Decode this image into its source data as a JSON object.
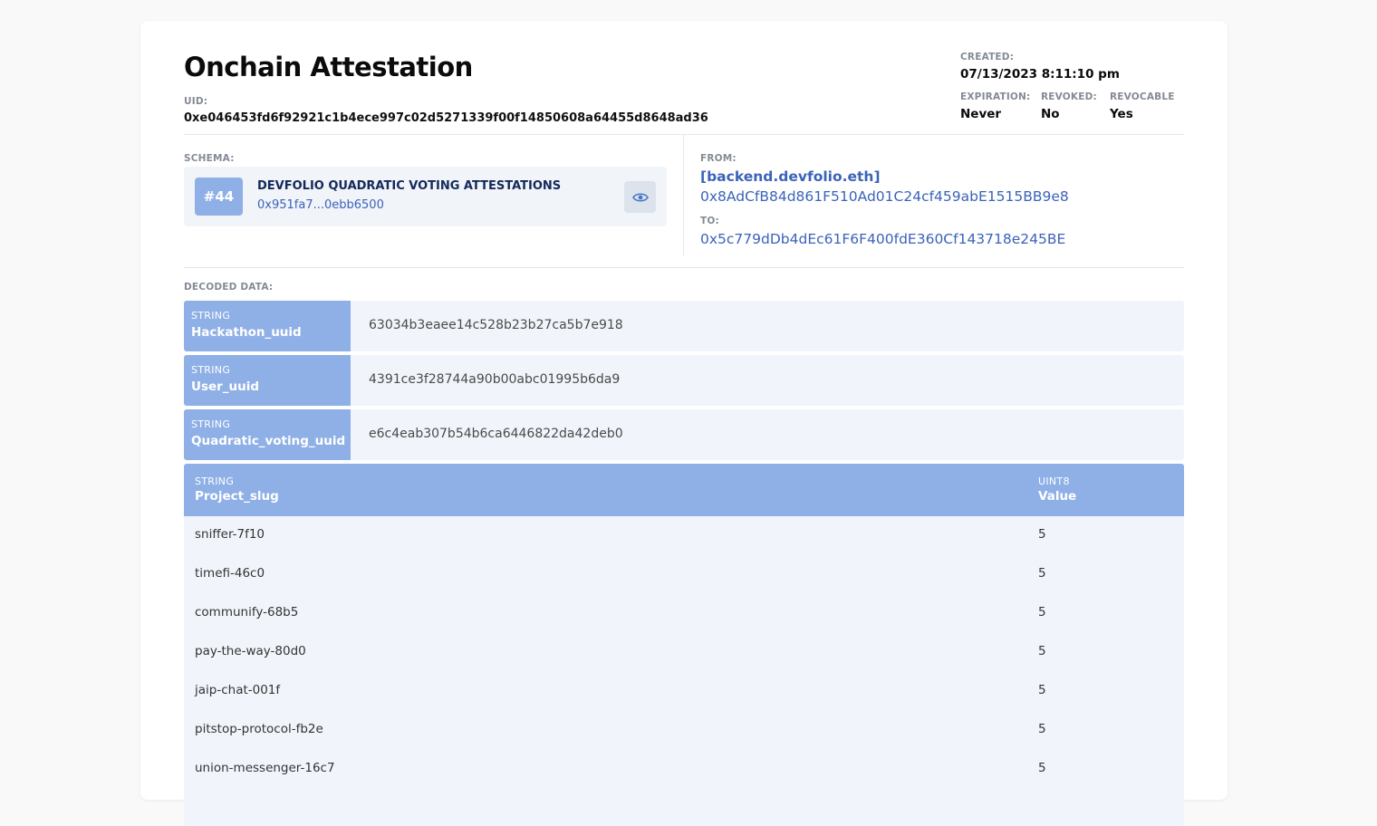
{
  "header": {
    "title": "Onchain Attestation",
    "uid_label": "UID:",
    "uid": "0xe046453fd6f92921c1b4ece997c02d5271339f00f14850608a64455d8648ad36"
  },
  "meta": {
    "created_label": "CREATED:",
    "created": "07/13/2023 8:11:10 pm",
    "expiration_label": "EXPIRATION:",
    "expiration": "Never",
    "revoked_label": "REVOKED:",
    "revoked": "No",
    "revocable_label": "REVOCABLE",
    "revocable": "Yes"
  },
  "schema": {
    "label": "SCHEMA:",
    "number": "#44",
    "name": "DEVFOLIO QUADRATIC VOTING ATTESTATIONS",
    "hash": "0x951fa7...0ebb6500",
    "view_icon": "eye-icon"
  },
  "parties": {
    "from_label": "FROM:",
    "from_name": "[backend.devfolio.eth]",
    "from_address": "0x8AdCfB84d861F510Ad01C24cf459abE1515BB9e8",
    "to_label": "TO:",
    "to_address": "0x5c779dDb4dEc61F6F400fdE360Cf143718e245BE"
  },
  "decoded": {
    "label": "DECODED DATA:",
    "fields": [
      {
        "type": "STRING",
        "name": "Hackathon_uuid",
        "value": "63034b3eaee14c528b23b27ca5b7e918"
      },
      {
        "type": "STRING",
        "name": "User_uuid",
        "value": "4391ce3f28744a90b00abc01995b6da9"
      },
      {
        "type": "STRING",
        "name": "Quadratic_voting_uuid",
        "value": "e6c4eab307b54b6ca6446822da42deb0"
      }
    ],
    "table": {
      "col1_type": "STRING",
      "col1_name": "Project_slug",
      "col2_type": "UINT8",
      "col2_name": "Value",
      "rows": [
        {
          "slug": "sniffer-7f10",
          "value": "5"
        },
        {
          "slug": "timefi-46c0",
          "value": "5"
        },
        {
          "slug": "communify-68b5",
          "value": "5"
        },
        {
          "slug": "pay-the-way-80d0",
          "value": "5"
        },
        {
          "slug": "jaip-chat-001f",
          "value": "5"
        },
        {
          "slug": "pitstop-protocol-fb2e",
          "value": "5"
        },
        {
          "slug": "union-messenger-16c7",
          "value": "5"
        }
      ]
    }
  },
  "colors": {
    "accent": "#8fb0e6",
    "link": "#3b63b8",
    "row_bg": "#f1f5fb"
  }
}
